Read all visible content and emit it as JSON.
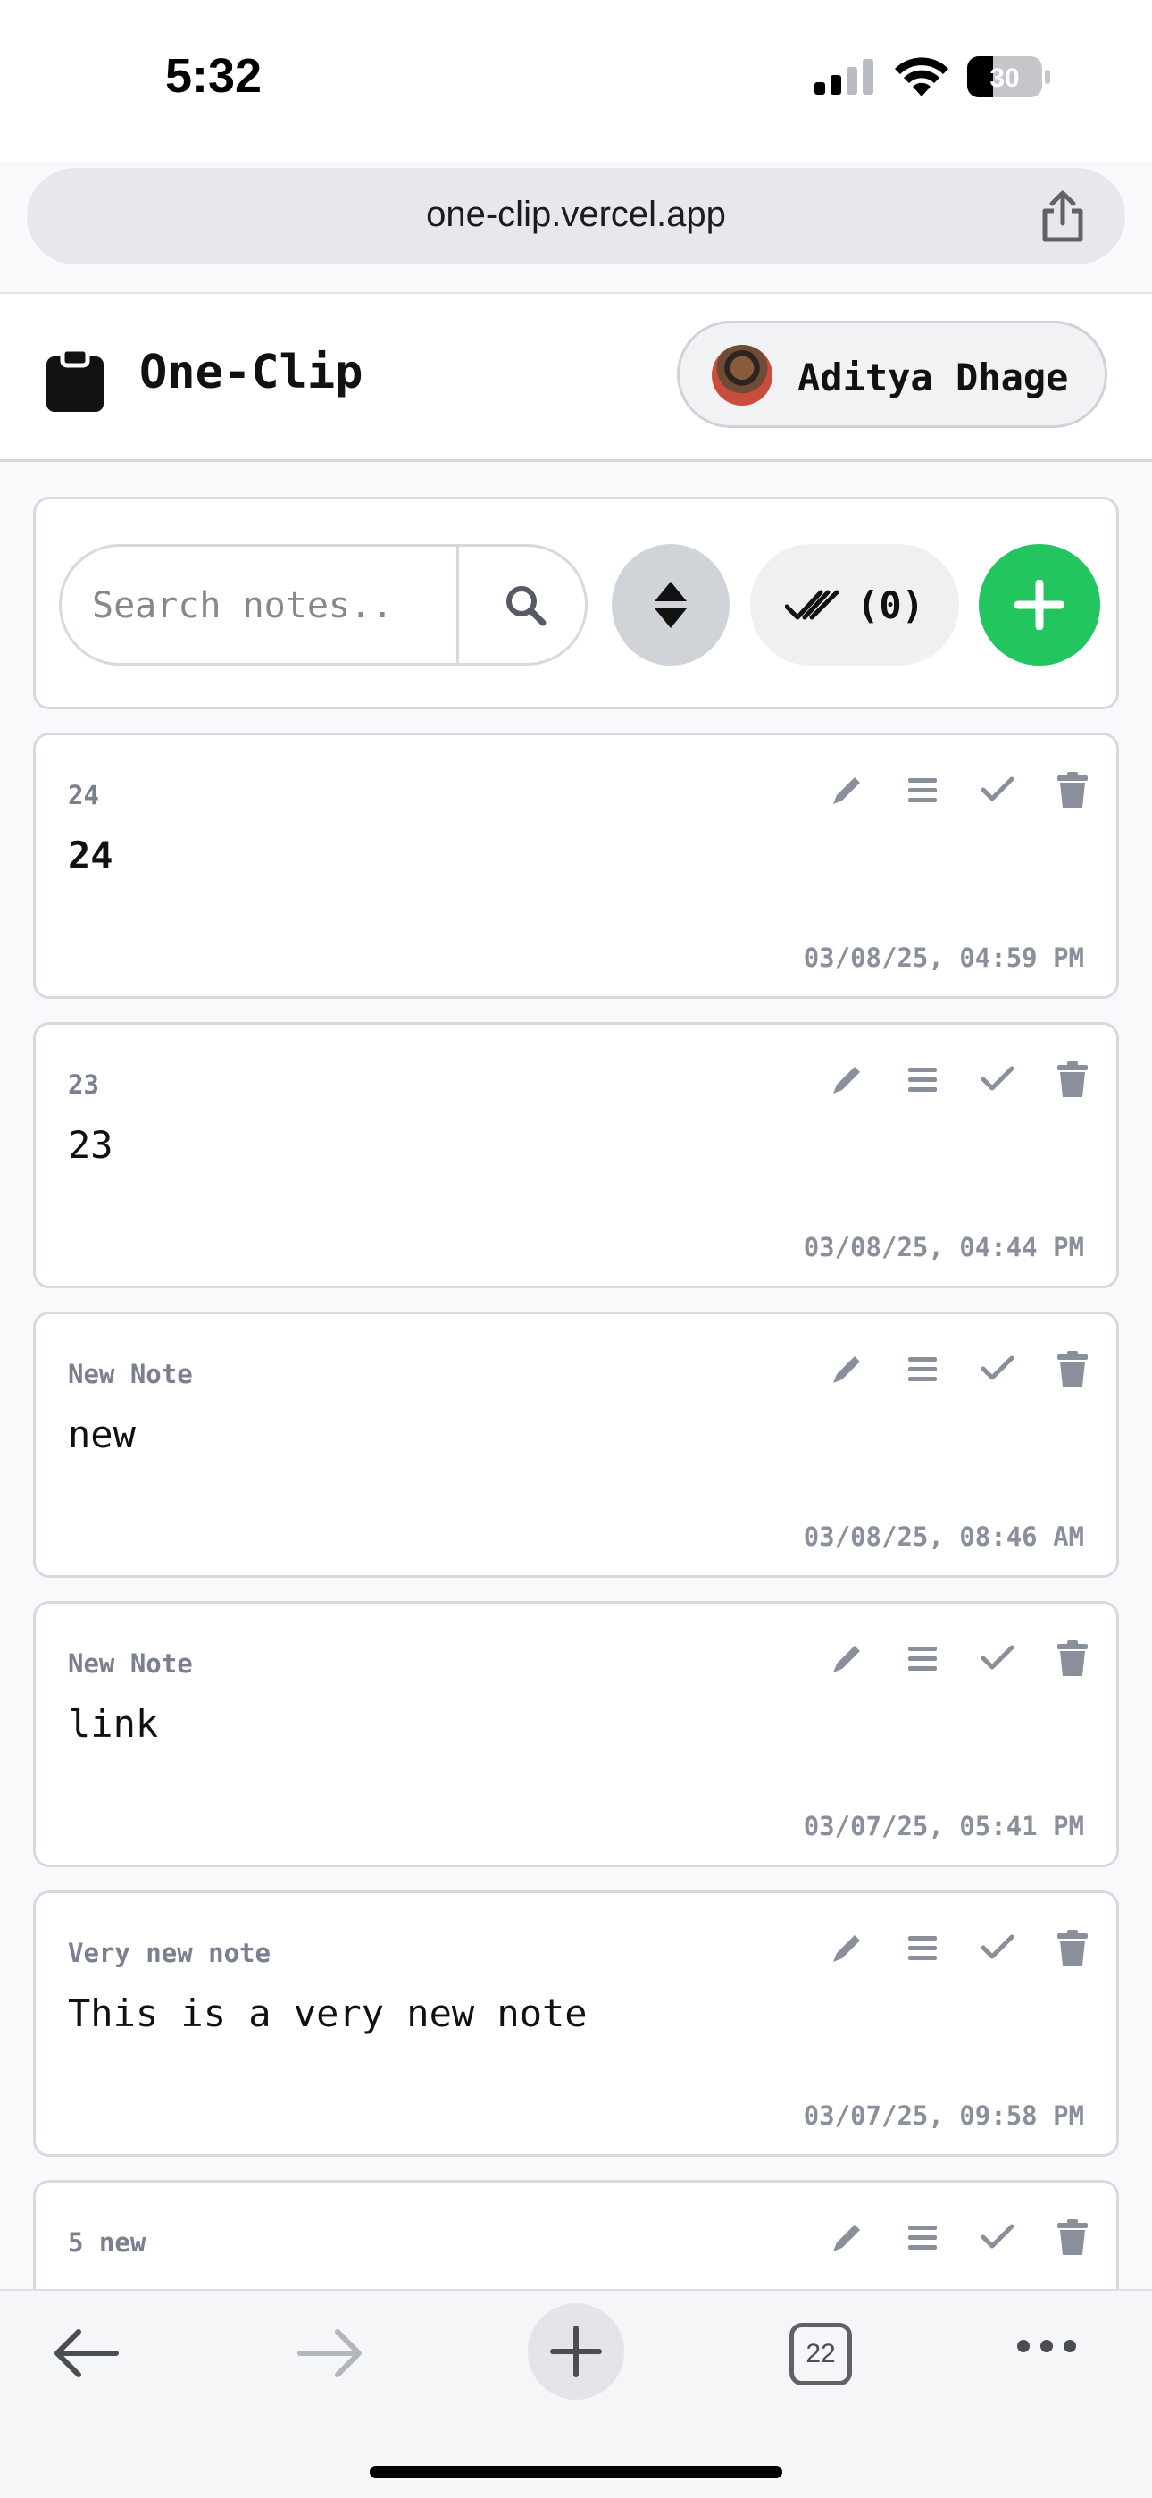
{
  "status_bar": {
    "time": "5:32",
    "battery": "30"
  },
  "browser": {
    "url": "one-clip.vercel.app",
    "tab_count": "22"
  },
  "header": {
    "title": "One-Clip",
    "user_name": "Aditya Dhage"
  },
  "toolbar": {
    "search_placeholder": "Search notes..",
    "selected_label": "(0)"
  },
  "notes": [
    {
      "title": "24",
      "body": "24",
      "date": "03/08/25, 04:59 PM",
      "bold": true
    },
    {
      "title": "23",
      "body": "23",
      "date": "03/08/25, 04:44 PM",
      "bold": false
    },
    {
      "title": "New Note",
      "body": "new",
      "date": "03/08/25, 08:46 AM",
      "bold": false
    },
    {
      "title": "New Note",
      "body": "link",
      "date": "03/07/25, 05:41 PM",
      "bold": false
    },
    {
      "title": "Very new note",
      "body": "This is a very new note",
      "date": "03/07/25, 09:58 PM",
      "bold": false
    },
    {
      "title": "5 new",
      "body": "",
      "date": "",
      "bold": false
    }
  ],
  "icons": {
    "logo": "clipboard-icon",
    "search": "search-icon",
    "sort": "sort-icon",
    "select_all": "double-check-icon",
    "add": "plus-icon",
    "edit": "pencil-icon",
    "drag": "menu-icon",
    "done": "check-icon",
    "delete": "trash-icon"
  },
  "colors": {
    "accent": "#22c55e",
    "muted_text": "#7a8090"
  }
}
